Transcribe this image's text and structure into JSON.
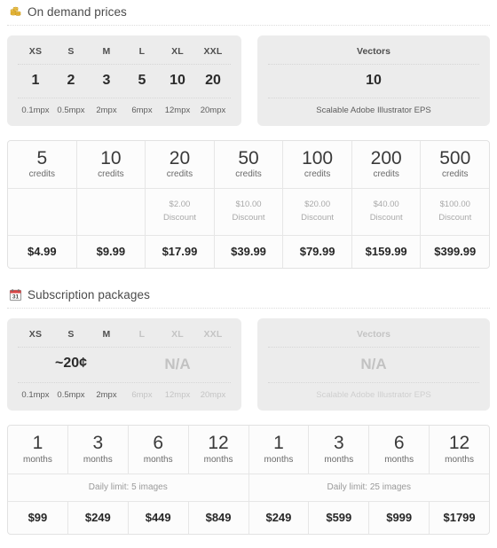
{
  "sections": [
    {
      "id": "on-demand",
      "icon": "coins-icon",
      "title": "On demand prices",
      "sizes_panel": {
        "labels": [
          "XS",
          "S",
          "M",
          "L",
          "XL",
          "XXL"
        ],
        "values": [
          "1",
          "2",
          "3",
          "5",
          "10",
          "20"
        ],
        "megapixels": [
          "0.1mpx",
          "0.5mpx",
          "2mpx",
          "6mpx",
          "12mpx",
          "20mpx"
        ]
      },
      "vectors_panel": {
        "title": "Vectors",
        "value": "10",
        "description": "Scalable Adobe Illustrator EPS"
      }
    },
    {
      "id": "subscription",
      "icon": "calendar-icon",
      "title": "Subscription packages",
      "sizes_panel": {
        "labels": [
          "XS",
          "S",
          "M",
          "L",
          "XL",
          "XXL"
        ],
        "price_group": "~20¢",
        "na_group": "N/A",
        "megapixels": [
          "0.1mpx",
          "0.5mpx",
          "2mpx",
          "6mpx",
          "12mpx",
          "20mpx"
        ]
      },
      "vectors_panel": {
        "title": "Vectors",
        "value": "N/A",
        "description": "Scalable Adobe Illustrator EPS"
      }
    }
  ],
  "credits_table": {
    "unit_label": "credits",
    "discount_label": "Discount",
    "columns": [
      {
        "qty": "5",
        "discount": "",
        "price": "$4.99"
      },
      {
        "qty": "10",
        "discount": "",
        "price": "$9.99"
      },
      {
        "qty": "20",
        "discount": "$2.00",
        "price": "$17.99"
      },
      {
        "qty": "50",
        "discount": "$10.00",
        "price": "$39.99"
      },
      {
        "qty": "100",
        "discount": "$20.00",
        "price": "$79.99"
      },
      {
        "qty": "200",
        "discount": "$40.00",
        "price": "$159.99"
      },
      {
        "qty": "500",
        "discount": "$100.00",
        "price": "$399.99"
      }
    ]
  },
  "subscription_table": {
    "unit_label": "months",
    "groups": [
      {
        "daily_limit": "Daily limit: 5 images",
        "columns": [
          {
            "qty": "1",
            "price": "$99"
          },
          {
            "qty": "3",
            "price": "$249"
          },
          {
            "qty": "6",
            "price": "$449"
          },
          {
            "qty": "12",
            "price": "$849"
          }
        ]
      },
      {
        "daily_limit": "Daily limit: 25 images",
        "columns": [
          {
            "qty": "1",
            "price": "$249"
          },
          {
            "qty": "3",
            "price": "$599"
          },
          {
            "qty": "6",
            "price": "$999"
          },
          {
            "qty": "12",
            "price": "$1799"
          }
        ]
      }
    ]
  },
  "colors": {
    "panel_bg": "#ececec",
    "page_bg": "#ffffff",
    "border": "#e2e2e2",
    "muted_text": "#c4c4c4",
    "coin_gold": "#e8b33a",
    "calendar_red": "#d94545"
  }
}
